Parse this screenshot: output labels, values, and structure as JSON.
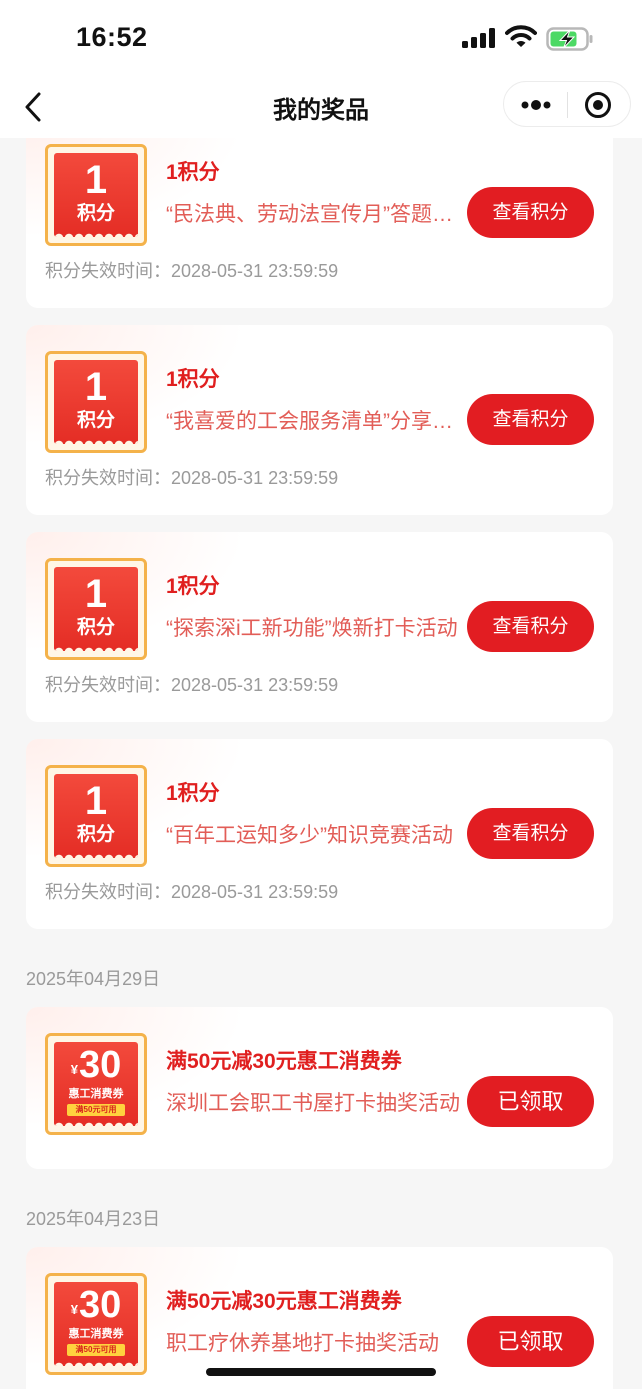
{
  "status_bar": {
    "time": "16:52"
  },
  "nav": {
    "title": "我的奖品"
  },
  "points_items": [
    {
      "amount": "1",
      "unit": "积分",
      "title": "1积分",
      "desc": "“民法典、劳动法宣传月”答题活动",
      "expire": "积分失效时间：2028-05-31 23:59:59",
      "button": "查看积分"
    },
    {
      "amount": "1",
      "unit": "积分",
      "title": "1积分",
      "desc": "“我喜爱的工会服务清单”分享活动",
      "expire": "积分失效时间：2028-05-31 23:59:59",
      "button": "查看积分"
    },
    {
      "amount": "1",
      "unit": "积分",
      "title": "1积分",
      "desc": "“探索深i工新功能”焕新打卡活动",
      "expire": "积分失效时间：2028-05-31 23:59:59",
      "button": "查看积分"
    },
    {
      "amount": "1",
      "unit": "积分",
      "title": "1积分",
      "desc": "“百年工运知多少”知识竞赛活动",
      "expire": "积分失效时间：2028-05-31 23:59:59",
      "button": "查看积分"
    }
  ],
  "coupon_groups": [
    {
      "date": "2025年04月29日",
      "coupon": {
        "currency": "¥",
        "amount": "30",
        "label": "惠工消费券",
        "condition": "满50元可用",
        "title": "满50元减30元惠工消费券",
        "desc": "深圳工会职工书屋打卡抽奖活动",
        "button": "已领取"
      }
    },
    {
      "date": "2025年04月23日",
      "coupon": {
        "currency": "¥",
        "amount": "30",
        "label": "惠工消费券",
        "condition": "满50元可用",
        "title": "满50元减30元惠工消费券",
        "desc": "职工疗休养基地打卡抽奖活动",
        "button": "已领取"
      }
    }
  ],
  "colors": {
    "accent": "#e21d22",
    "title_red": "#e01f1f",
    "badge_border": "#f4b24a",
    "muted": "#9a9a9a"
  },
  "icons": [
    "signal-icon",
    "wifi-icon",
    "battery-charging-icon",
    "back-arrow-icon",
    "more-dots-icon",
    "target-icon"
  ]
}
